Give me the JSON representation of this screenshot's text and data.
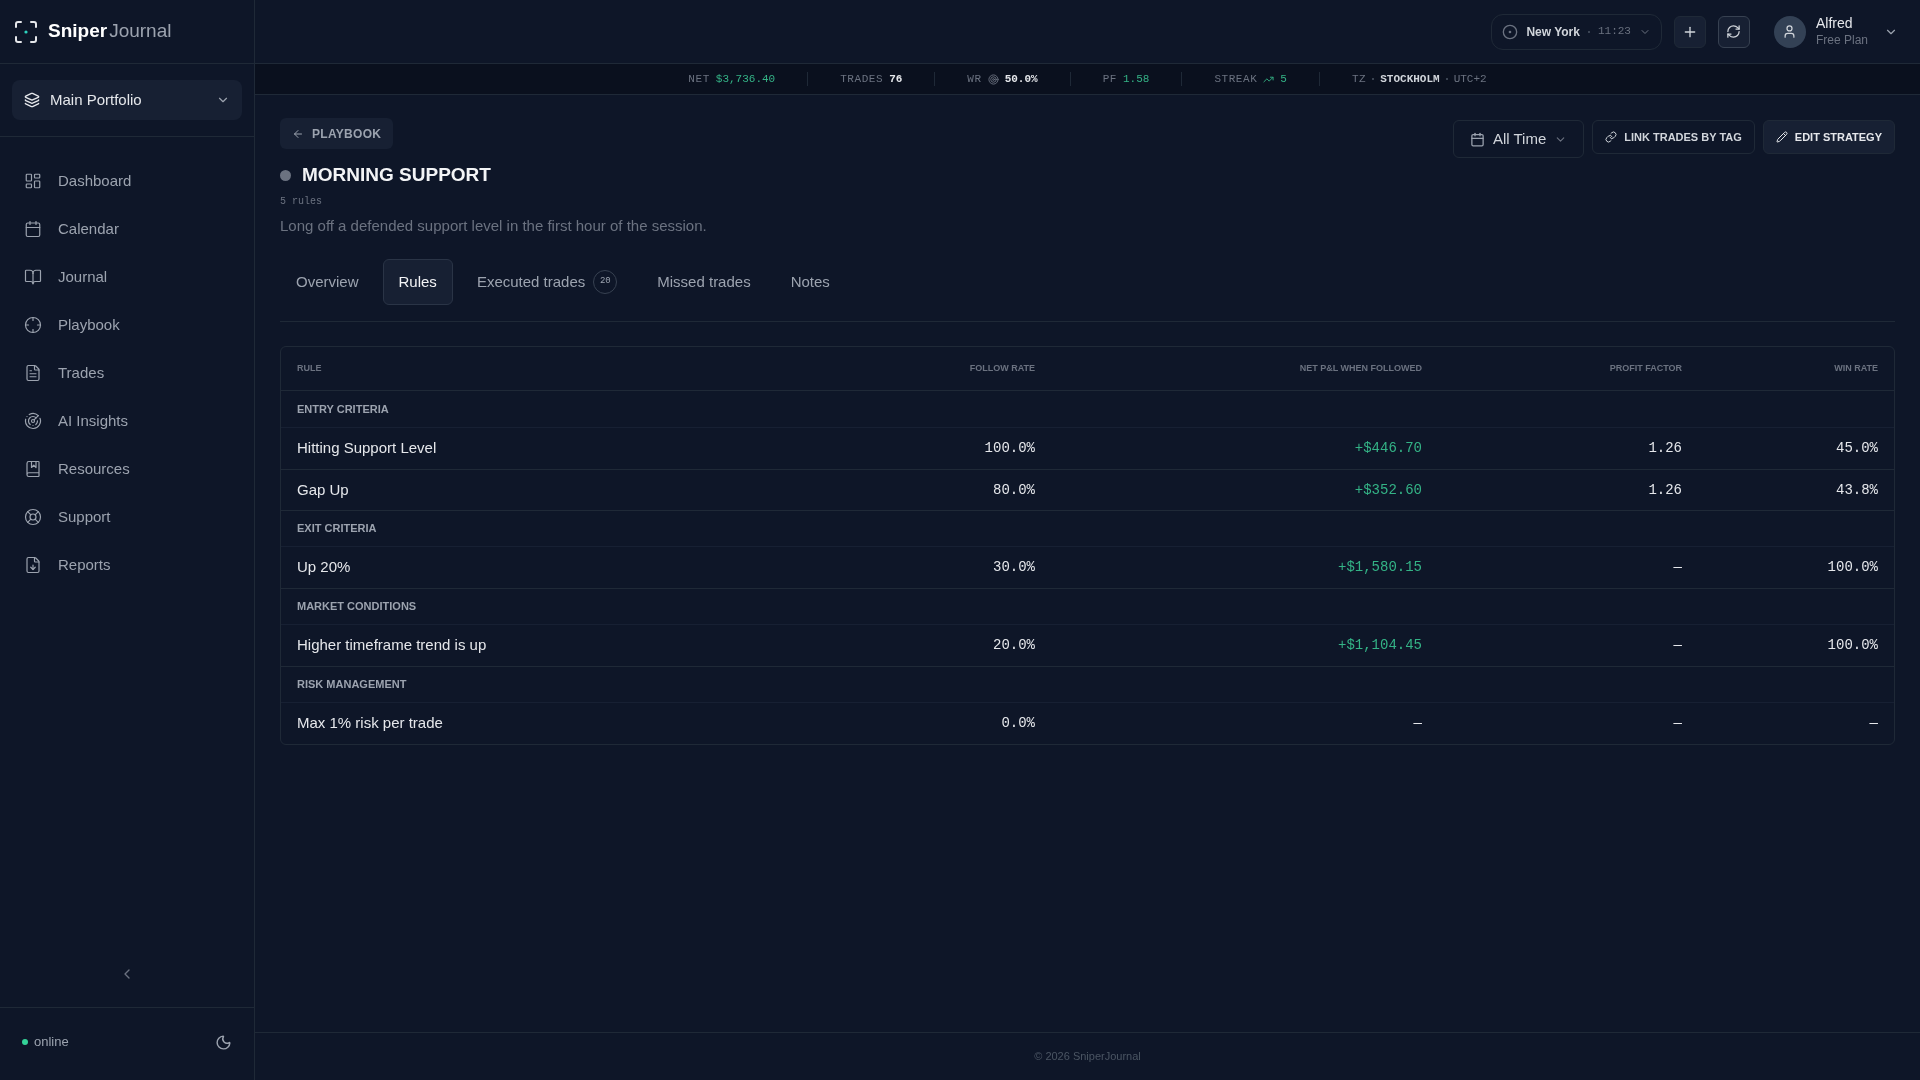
{
  "brand": {
    "bold": "Sniper",
    "light": "Journal"
  },
  "portfolio": {
    "label": "Main Portfolio"
  },
  "nav": [
    {
      "label": "Dashboard"
    },
    {
      "label": "Calendar"
    },
    {
      "label": "Journal"
    },
    {
      "label": "Playbook"
    },
    {
      "label": "Trades"
    },
    {
      "label": "AI Insights"
    },
    {
      "label": "Resources"
    },
    {
      "label": "Support"
    },
    {
      "label": "Reports"
    }
  ],
  "status": {
    "label": "online",
    "online": true
  },
  "topbar": {
    "city": "New York",
    "time": "11:23",
    "user": {
      "name": "Alfred",
      "plan": "Free Plan"
    }
  },
  "stats": [
    {
      "kind": "money",
      "label": "NET",
      "value": "$3,736.40"
    },
    {
      "kind": "count",
      "label": "TRADES",
      "value": "76"
    },
    {
      "kind": "ratio",
      "label": "WR",
      "value": "50.0%"
    },
    {
      "kind": "factor",
      "label": "PF",
      "value": "1.58"
    },
    {
      "kind": "streak",
      "label": "STREAK",
      "value": "5"
    },
    {
      "kind": "tz",
      "label": "TZ",
      "value": "STOCKHOLM",
      "extra": "UTC+2"
    }
  ],
  "back": "PLAYBOOK",
  "strategy": {
    "title": "MORNING SUPPORT",
    "rules_count": "5 rules",
    "description": "Long off a defended support level in the first hour of the session."
  },
  "actions": {
    "range": "All Time",
    "buttons": [
      {
        "kind": "link",
        "label": "LINK TRADES BY TAG"
      },
      {
        "kind": "edit",
        "label": "EDIT STRATEGY"
      }
    ]
  },
  "tabs": [
    {
      "label": "Overview",
      "selected": false
    },
    {
      "label": "Rules",
      "selected": true
    },
    {
      "label": "Executed trades",
      "selected": false,
      "badge": "20"
    },
    {
      "label": "Missed trades",
      "selected": false
    },
    {
      "label": "Notes",
      "selected": false
    }
  ],
  "table": {
    "columns": [
      "RULE",
      "FOLLOW RATE",
      "NET P&L WHEN FOLLOWED",
      "PROFIT FACTOR",
      "WIN RATE"
    ],
    "groups": [
      {
        "name": "ENTRY CRITERIA",
        "rows": [
          {
            "rule": "Hitting Support Level",
            "follow_rate": "100.0%",
            "net_pnl": "+$446.70",
            "positive": true,
            "profit_factor": "1.26",
            "win_rate": "45.0%"
          },
          {
            "rule": "Gap Up",
            "follow_rate": "80.0%",
            "net_pnl": "+$352.60",
            "positive": true,
            "profit_factor": "1.26",
            "win_rate": "43.8%"
          }
        ]
      },
      {
        "name": "EXIT CRITERIA",
        "rows": [
          {
            "rule": "Up 20%",
            "follow_rate": "30.0%",
            "net_pnl": "+$1,580.15",
            "positive": true,
            "profit_factor": "—",
            "win_rate": "100.0%"
          }
        ]
      },
      {
        "name": "MARKET CONDITIONS",
        "rows": [
          {
            "rule": "Higher timeframe trend is up",
            "follow_rate": "20.0%",
            "net_pnl": "+$1,104.45",
            "positive": true,
            "profit_factor": "—",
            "win_rate": "100.0%"
          }
        ]
      },
      {
        "name": "RISK MANAGEMENT",
        "rows": [
          {
            "rule": "Max 1% risk per trade",
            "follow_rate": "0.0%",
            "net_pnl": "—",
            "positive": false,
            "profit_factor": "—",
            "win_rate": "—"
          }
        ]
      }
    ]
  },
  "footer": "© 2026 SniperJournal"
}
